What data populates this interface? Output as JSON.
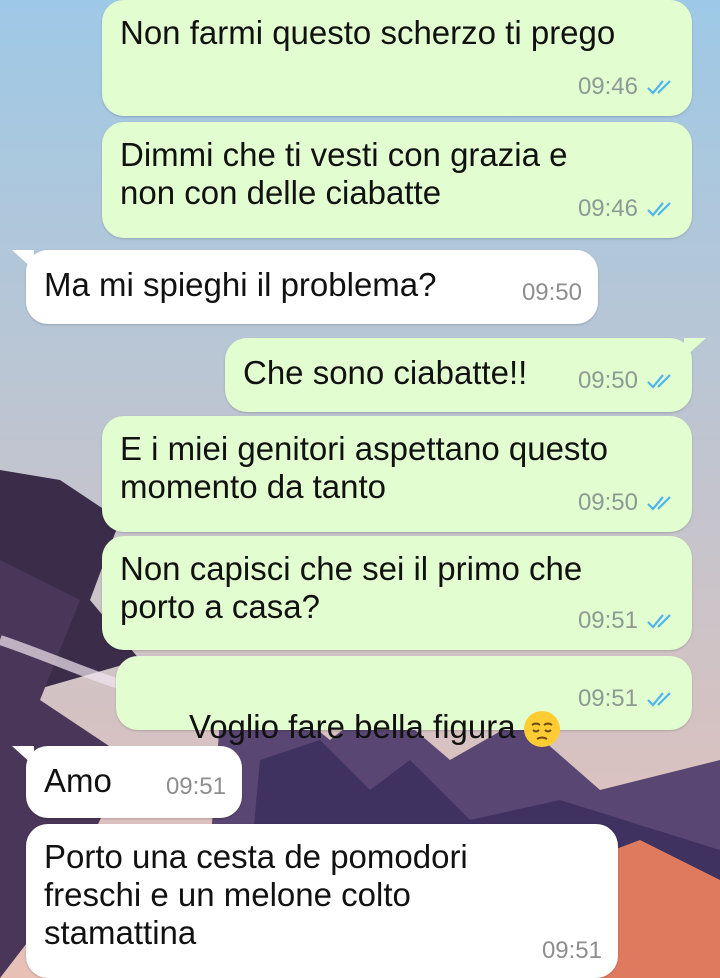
{
  "messages": [
    {
      "dir": "out",
      "text": "Non farmi questo scherzo ti prego",
      "time": "09:46"
    },
    {
      "dir": "out",
      "text": "Dimmi che ti vesti con grazia e\nnon con delle ciabatte",
      "time": "09:46"
    },
    {
      "dir": "in",
      "text": "Ma mi spieghi il problema?",
      "time": "09:50"
    },
    {
      "dir": "out",
      "text": "Che sono ciabatte!!",
      "time": "09:50"
    },
    {
      "dir": "out",
      "text": "E i miei genitori aspettano questo\nmomento da tanto",
      "time": "09:50"
    },
    {
      "dir": "out",
      "text": "Non capisci che sei il primo che\nporto a casa?",
      "time": "09:51"
    },
    {
      "dir": "out",
      "text": "Voglio fare bella figura",
      "time": "09:51",
      "emoji": "pensive-face-icon"
    },
    {
      "dir": "in",
      "text": "Amo",
      "time": "09:51"
    },
    {
      "dir": "in",
      "text": "Porto una cesta de pomodori\nfreschi e un melone colto\nstamattina",
      "time": "09:51"
    }
  ],
  "colors": {
    "outgoing_bubble": "#e2fdcf",
    "incoming_bubble": "#ffffff",
    "read_ticks": "#4fb6ec"
  },
  "icons": {
    "read_receipt": "double-check-icon"
  }
}
